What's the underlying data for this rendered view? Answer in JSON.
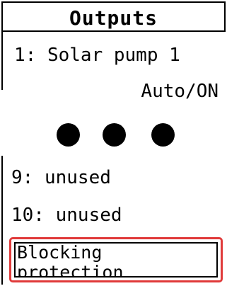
{
  "header": {
    "title": "Outputs"
  },
  "outputs": {
    "entry1": {
      "label": "1: Solar pump 1",
      "state": "Auto/ON"
    },
    "entry9": {
      "label": "9: unused"
    },
    "entry10": {
      "label": "10: unused"
    }
  },
  "menu": {
    "selected_label": "Blocking\nprotection"
  },
  "colors": {
    "selection_border": "#e03a3a"
  }
}
